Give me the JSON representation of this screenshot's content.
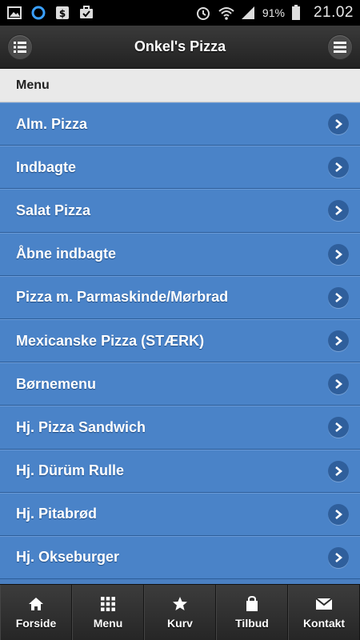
{
  "status_bar": {
    "battery": "91%",
    "time": "21.02"
  },
  "header": {
    "title": "Onkel's Pizza"
  },
  "section": {
    "label": "Menu"
  },
  "menu_items": [
    {
      "label": "Alm. Pizza"
    },
    {
      "label": "Indbagte"
    },
    {
      "label": "Salat Pizza"
    },
    {
      "label": "Åbne indbagte"
    },
    {
      "label": "Pizza m. Parmaskinde/Mørbrad"
    },
    {
      "label": "Mexicanske Pizza (STÆRK)"
    },
    {
      "label": "Børnemenu"
    },
    {
      "label": "Hj. Pizza Sandwich"
    },
    {
      "label": "Hj. Dürüm Rulle"
    },
    {
      "label": "Hj. Pitabrød"
    },
    {
      "label": "Hj. Okseburger"
    }
  ],
  "bottom_nav": [
    {
      "label": "Forside",
      "icon": "home-icon"
    },
    {
      "label": "Menu",
      "icon": "grid-icon"
    },
    {
      "label": "Kurv",
      "icon": "star-icon"
    },
    {
      "label": "Tilbud",
      "icon": "bag-icon"
    },
    {
      "label": "Kontakt",
      "icon": "mail-icon"
    }
  ],
  "colors": {
    "list_bg": "#4a83c8",
    "header_bg": "#2a2a2a",
    "divider_bg": "#e9e9e9"
  }
}
